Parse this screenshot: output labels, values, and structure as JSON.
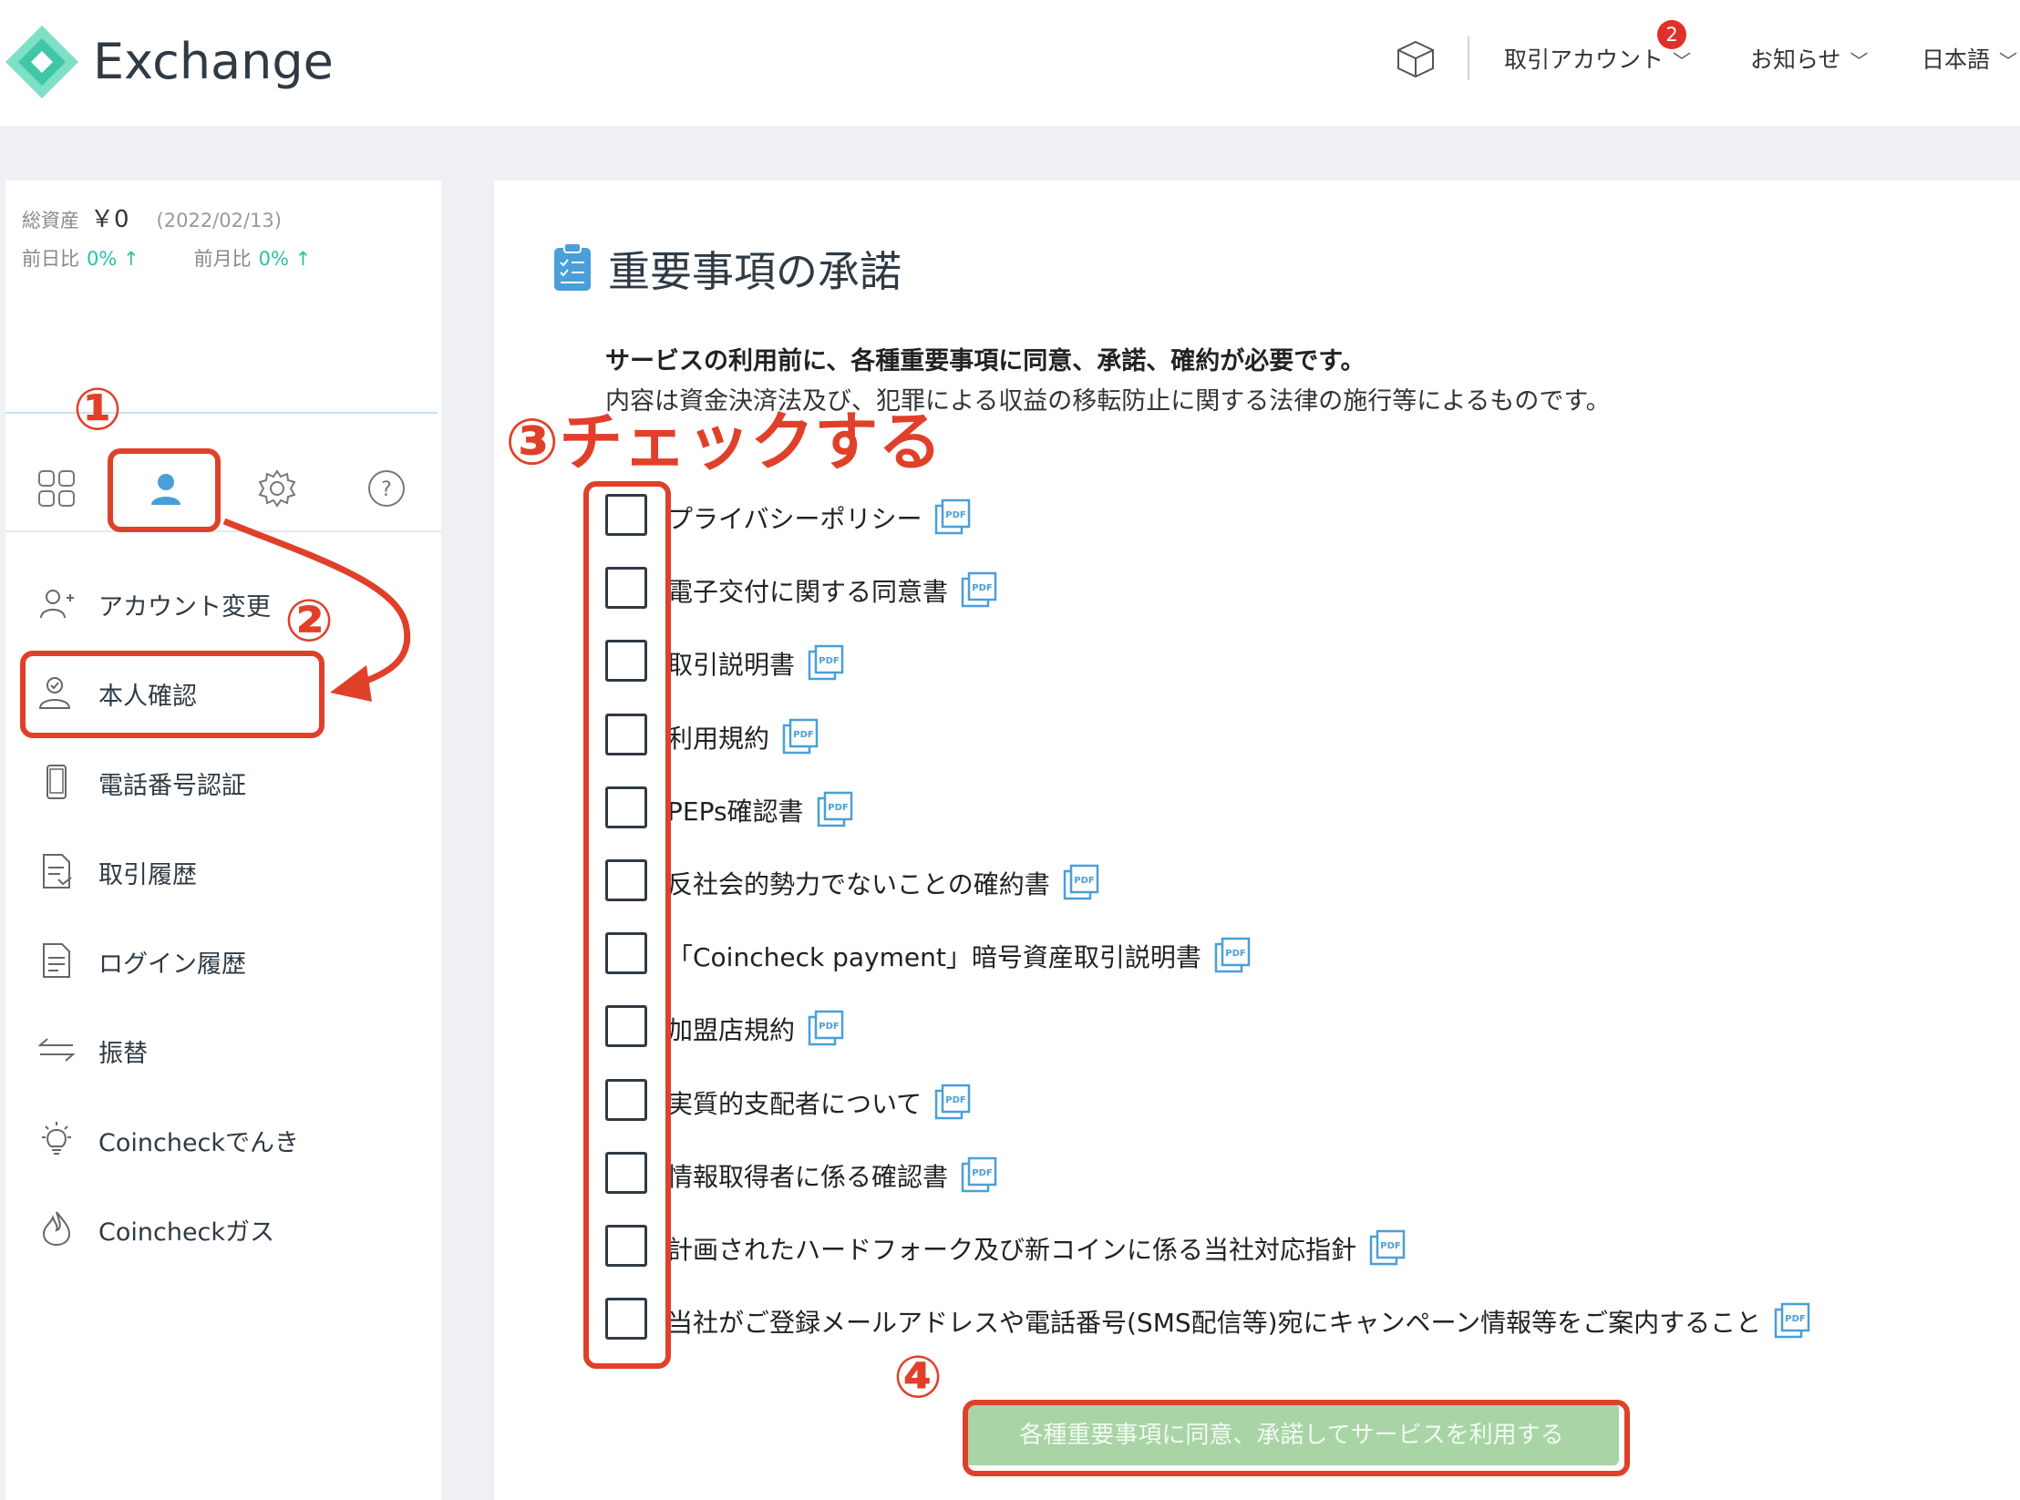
{
  "header": {
    "brand": "Exchange",
    "nav": {
      "account": "取引アカウント",
      "account_badge": "2",
      "news": "お知らせ",
      "language": "日本語"
    }
  },
  "sidebar": {
    "total_assets_label": "総資産",
    "total_assets_value": "￥0",
    "total_assets_date": "(2022/02/13)",
    "day_change_label": "前日比",
    "day_change_value": "0% ↑",
    "month_change_label": "前月比",
    "month_change_value": "0% ↑",
    "tabs": [
      "grid-icon",
      "user-icon",
      "gear-icon",
      "help-icon"
    ],
    "menu": [
      {
        "label": "アカウント変更",
        "icon": "add-user-icon"
      },
      {
        "label": "本人確認",
        "icon": "verified-user-icon"
      },
      {
        "label": "電話番号認証",
        "icon": "phone-icon"
      },
      {
        "label": "取引履歴",
        "icon": "document-download-icon"
      },
      {
        "label": "ログイン履歴",
        "icon": "document-icon"
      },
      {
        "label": "振替",
        "icon": "transfer-icon"
      },
      {
        "label": "Coincheckでんき",
        "icon": "lightbulb-icon"
      },
      {
        "label": "Coincheckガス",
        "icon": "flame-icon"
      }
    ]
  },
  "main": {
    "title": "重要事項の承諾",
    "intro_bold": "サービスの利用前に、各種重要事項に同意、承諾、確約が必要です。",
    "intro_text": "内容は資金決済法及び、犯罪による収益の移転防止に関する法律の施行等によるものです。",
    "terms": [
      {
        "label": "プライバシーポリシー",
        "checked": false
      },
      {
        "label": "電子交付に関する同意書",
        "checked": false
      },
      {
        "label": "取引説明書",
        "checked": false
      },
      {
        "label": "利用規約",
        "checked": false
      },
      {
        "label": "PEPs確認書",
        "checked": false
      },
      {
        "label": "反社会的勢力でないことの確約書",
        "checked": false
      },
      {
        "label": "「Coincheck payment」暗号資産取引説明書",
        "checked": false
      },
      {
        "label": "加盟店規約",
        "checked": false
      },
      {
        "label": "実質的支配者について",
        "checked": false
      },
      {
        "label": "情報取得者に係る確認書",
        "checked": false
      },
      {
        "label": "計画されたハードフォーク及び新コインに係る当社対応指針",
        "checked": false
      },
      {
        "label": "当社がご登録メールアドレスや電話番号(SMS配信等)宛にキャンペーン情報等をご案内すること",
        "checked": false
      }
    ],
    "submit_label": "各種重要事項に同意、承諾してサービスを利用する"
  },
  "annotations": {
    "step1": "①",
    "step2": "②",
    "step3": "③チェックする",
    "step4": "④"
  },
  "colors": {
    "annotation": "#e0402a",
    "accent_teal": "#27c2a4",
    "button_disabled": "#a8d4a6",
    "badge": "#e0302a",
    "icon_blue": "#4a9fd8"
  }
}
